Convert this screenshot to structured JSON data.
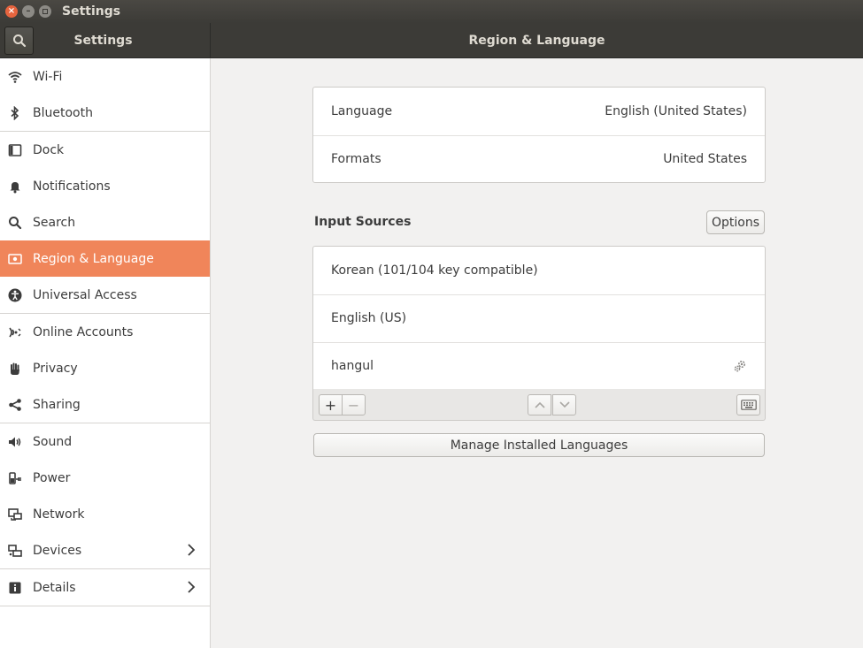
{
  "window": {
    "title": "Settings"
  },
  "header": {
    "left_title": "Settings",
    "right_title": "Region & Language"
  },
  "sidebar": {
    "items": [
      {
        "label": "Wi-Fi"
      },
      {
        "label": "Bluetooth"
      },
      {
        "label": "Dock"
      },
      {
        "label": "Notifications"
      },
      {
        "label": "Search"
      },
      {
        "label": "Region & Language",
        "active": true
      },
      {
        "label": "Universal Access"
      },
      {
        "label": "Online Accounts"
      },
      {
        "label": "Privacy"
      },
      {
        "label": "Sharing"
      },
      {
        "label": "Sound"
      },
      {
        "label": "Power"
      },
      {
        "label": "Network"
      },
      {
        "label": "Devices"
      },
      {
        "label": "Details"
      }
    ]
  },
  "language_panel": {
    "rows": [
      {
        "label": "Language",
        "value": "English (United States)"
      },
      {
        "label": "Formats",
        "value": "United States"
      }
    ]
  },
  "input_sources": {
    "title": "Input Sources",
    "options_label": "Options",
    "items": [
      {
        "label": "Korean (101/104 key compatible)"
      },
      {
        "label": "English (US)"
      },
      {
        "label": "hangul",
        "has_settings": true
      }
    ],
    "add_label": "+",
    "remove_label": "−"
  },
  "manage_button_label": "Manage Installed Languages",
  "colors": {
    "accent": "#f0855a",
    "titlebar": "#3c3b37",
    "close_button": "#e6643e"
  }
}
